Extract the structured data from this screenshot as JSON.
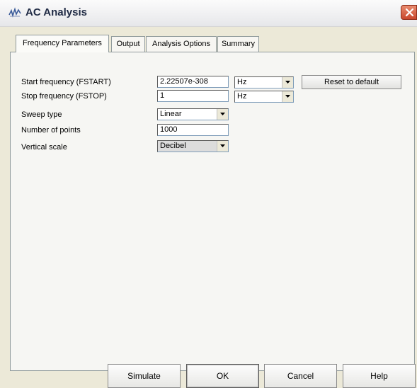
{
  "window": {
    "title": "AC Analysis",
    "icon": "waveform-icon",
    "close_icon": "close-icon"
  },
  "tabs": [
    {
      "label": "Frequency Parameters",
      "active": true
    },
    {
      "label": "Output",
      "active": false
    },
    {
      "label": "Analysis Options",
      "active": false
    },
    {
      "label": "Summary",
      "active": false
    }
  ],
  "form": {
    "start_frequency": {
      "label": "Start frequency (FSTART)",
      "value": "2.22507e-308",
      "unit": "Hz"
    },
    "stop_frequency": {
      "label": "Stop frequency (FSTOP)",
      "value": "1",
      "unit": "Hz"
    },
    "sweep_type": {
      "label": "Sweep type",
      "value": "Linear"
    },
    "number_of_points": {
      "label": "Number of points",
      "value": "1000"
    },
    "vertical_scale": {
      "label": "Vertical scale",
      "value": "Decibel",
      "disabled": true
    },
    "reset_label": "Reset to default"
  },
  "buttons": {
    "simulate": "Simulate",
    "ok": "OK",
    "cancel": "Cancel",
    "help": "Help"
  }
}
